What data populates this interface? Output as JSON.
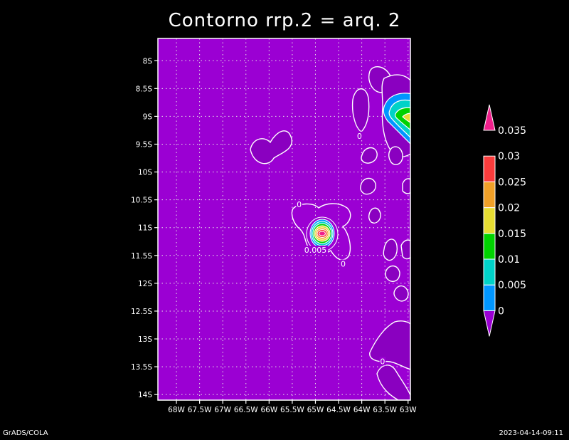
{
  "chart_data": {
    "type": "heatmap",
    "title": "Contorno rrp.2 = arq. 2",
    "x_ticks": [
      "68W",
      "67.5W",
      "67W",
      "66.5W",
      "66W",
      "65.5W",
      "65W",
      "64.5W",
      "64W",
      "63.5W",
      "63W"
    ],
    "x_values": [
      -68,
      -67.5,
      -67,
      -66.5,
      -66,
      -65.5,
      -65,
      -64.5,
      -64,
      -63.5,
      -63
    ],
    "y_ticks": [
      "8S",
      "8.5S",
      "9S",
      "9.5S",
      "10S",
      "10.5S",
      "11S",
      "11.5S",
      "12S",
      "12.5S",
      "13S",
      "13.5S",
      "14S"
    ],
    "y_values": [
      -8,
      -8.5,
      -9,
      -9.5,
      -10,
      -10.5,
      -11,
      -11.5,
      -12,
      -12.5,
      -13,
      -13.5,
      -14
    ],
    "xlim": [
      -68.4,
      -62.95
    ],
    "ylim": [
      -14.1,
      -7.6
    ],
    "grid": true,
    "colorbar": {
      "placement": "right",
      "levels": [
        "0",
        "0.005",
        "0.01",
        "0.015",
        "0.02",
        "0.025",
        "0.03",
        "0.035"
      ],
      "colors": [
        "#9b00d3",
        "#0096ff",
        "#00d2c8",
        "#00d200",
        "#e6dc32",
        "#f0a028",
        "#fa3c3c",
        "#f0208c"
      ]
    },
    "contour_labels": [
      {
        "text": "0",
        "lon": -65.35,
        "lat": -10.58
      },
      {
        "text": "0",
        "lon": -64.05,
        "lat": -9.35
      },
      {
        "text": "0.005",
        "lon": -65.0,
        "lat": -11.4
      },
      {
        "text": "0",
        "lon": -64.4,
        "lat": -11.65
      },
      {
        "text": "0",
        "lon": -63.55,
        "lat": -13.4
      }
    ]
  },
  "footer": {
    "left": "GrADS/COLA",
    "right": "2023-04-14-09:11"
  }
}
